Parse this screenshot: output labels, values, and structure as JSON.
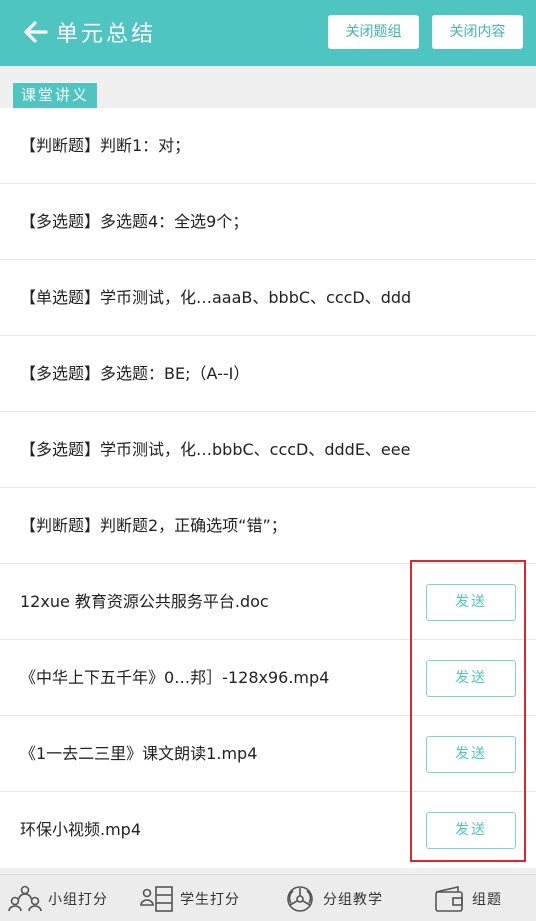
{
  "header": {
    "title": "单元总结",
    "close_group_label": "关闭题组",
    "close_content_label": "关闭内容"
  },
  "section_tag": "课堂讲义",
  "questions": [
    "【判断题】判断1：对；",
    "【多选题】多选题4：全选9个；",
    "【单选题】学币测试，化…aaaB、bbbC、cccD、ddd",
    "【多选题】多选题：BE;（A--I）",
    "【多选题】学币测试，化…bbbC、cccD、dddE、eee",
    "【判断题】判断题2，正确选项“错”；"
  ],
  "files": [
    {
      "name": "12xue 教育资源公共服务平台.doc",
      "action": "发送"
    },
    {
      "name": "《中华上下五千年》0…邦］-128x96.mp4",
      "action": "发送"
    },
    {
      "name": "《1一去二三里》课文朗读1.mp4",
      "action": "发送"
    },
    {
      "name": "环保小视频.mp4",
      "action": "发送"
    }
  ],
  "bottom_nav": [
    {
      "label": "小组打分",
      "icon": "group-people-icon"
    },
    {
      "label": "学生打分",
      "icon": "student-list-icon"
    },
    {
      "label": "分组教学",
      "icon": "group-teaching-icon"
    },
    {
      "label": "组题",
      "icon": "wallet-icon"
    }
  ],
  "colors": {
    "accent": "#4fc5c2",
    "highlight_border": "#e0262a"
  }
}
